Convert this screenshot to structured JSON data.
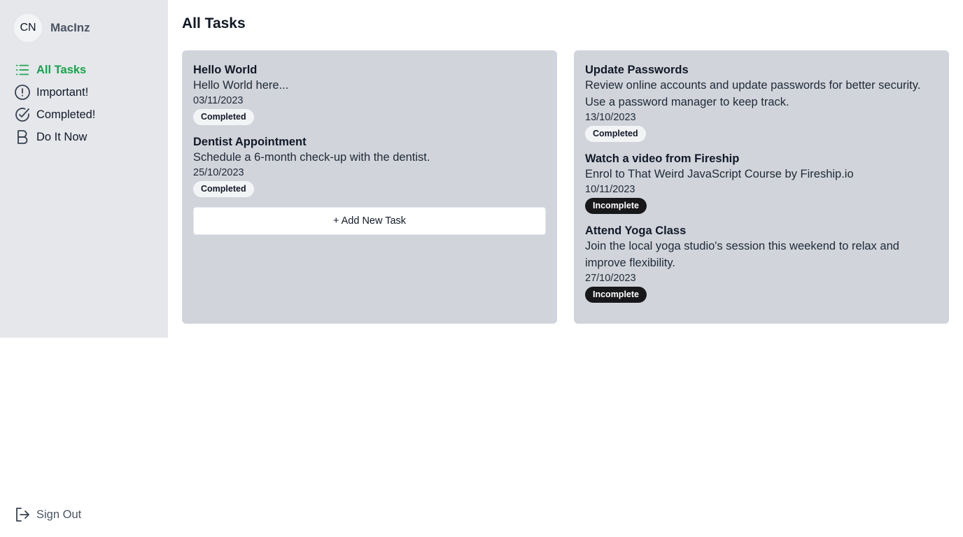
{
  "user": {
    "initials": "CN",
    "name": "MacInz"
  },
  "nav": {
    "items": [
      {
        "label": "All Tasks",
        "icon": "list-icon",
        "active": true
      },
      {
        "label": "Important!",
        "icon": "alert-circle-icon",
        "active": false
      },
      {
        "label": "Completed!",
        "icon": "check-circle-icon",
        "active": false
      },
      {
        "label": "Do It Now",
        "icon": "bold-b-icon",
        "active": false
      }
    ],
    "signout": {
      "label": "Sign Out",
      "icon": "sign-out-icon"
    }
  },
  "page": {
    "title": "All Tasks"
  },
  "columns": {
    "left": {
      "tasks": [
        {
          "title": "Hello World",
          "desc_lines": [
            "Hello World here..."
          ],
          "date": "03/11/2023",
          "status": "Completed"
        },
        {
          "title": "Dentist Appointment",
          "desc_lines": [
            "Schedule a 6-month check-up with the dentist."
          ],
          "date": "25/10/2023",
          "status": "Completed"
        }
      ],
      "add_label": "+ Add New Task"
    },
    "right": {
      "tasks": [
        {
          "title": "Update Passwords",
          "desc_lines": [
            "Review online accounts and update passwords for better security.",
            "Use a password manager to keep track."
          ],
          "date": "13/10/2023",
          "status": "Completed"
        },
        {
          "title": "Watch a video from Fireship",
          "desc_lines": [
            "Enrol to That Weird JavaScript Course by Fireship.io"
          ],
          "date": "10/11/2023",
          "status": "Incomplete"
        },
        {
          "title": "Attend Yoga Class",
          "desc_lines": [
            "Join the local yoga studio's session this weekend to relax and",
            "improve flexibility."
          ],
          "date": "27/10/2023",
          "status": "Incomplete"
        }
      ]
    }
  },
  "colors": {
    "accent": "#16a34a",
    "sidebar_bg": "#e5e7eb",
    "column_bg": "#d1d5db",
    "incomplete_badge": "#18181b",
    "completed_badge": "#f3f4f6"
  }
}
